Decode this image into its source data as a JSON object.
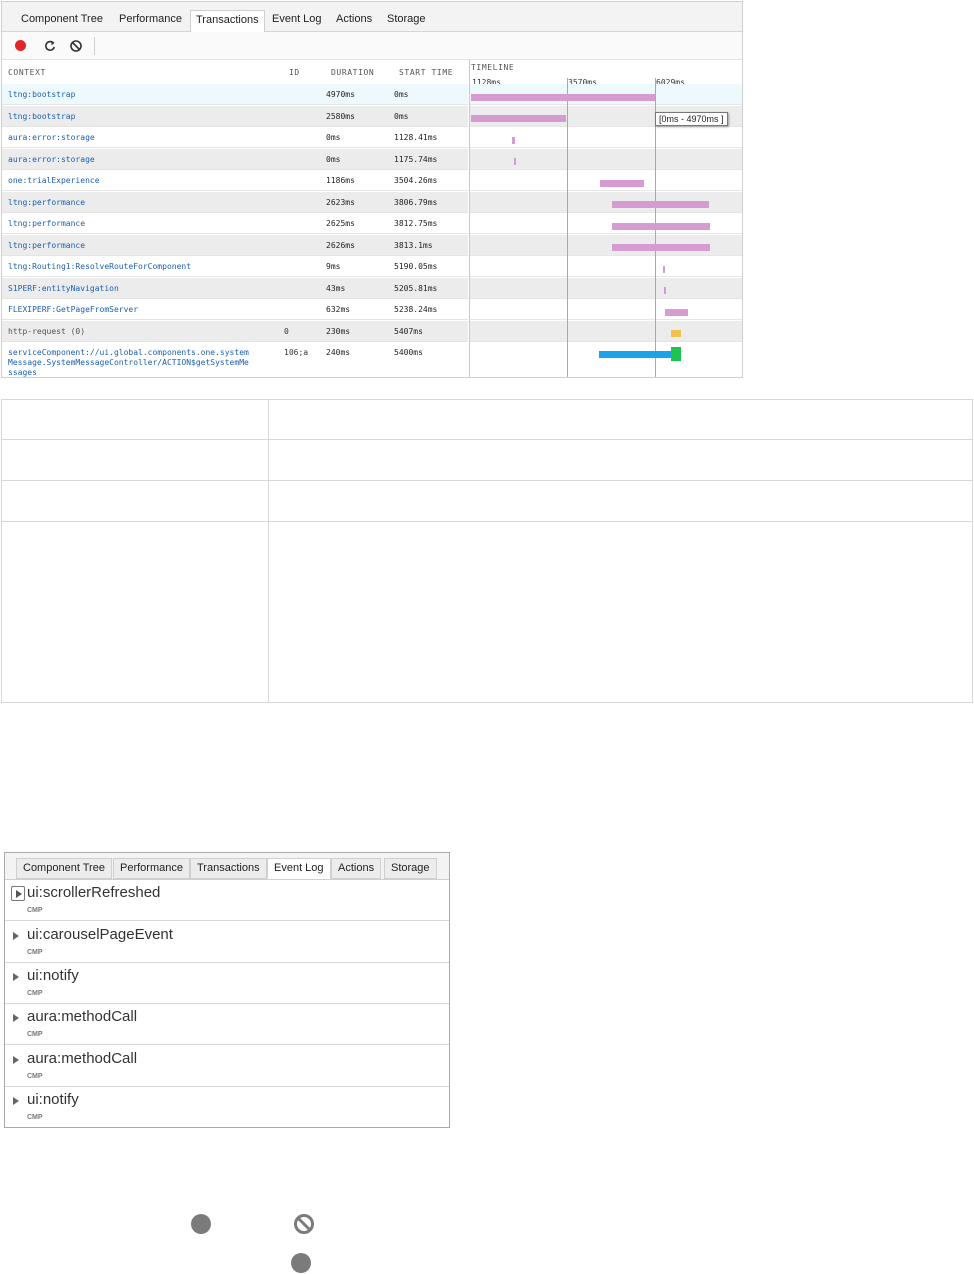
{
  "transactions_panel": {
    "tabs": [
      "Component Tree",
      "Performance",
      "Transactions",
      "Event Log",
      "Actions",
      "Storage"
    ],
    "active_tab": "Transactions",
    "toolbar": {
      "record": "record-icon",
      "refresh": "refresh-icon",
      "clear": "clear-icon"
    },
    "columns": {
      "context": "CONTEXT",
      "id": "ID",
      "duration": "DURATION",
      "start_time": "START TIME",
      "timeline": "TIMELINE"
    },
    "timeline_ticks": [
      "1128ms",
      "3570ms",
      "6029ms"
    ],
    "tooltip": "[0ms - 4970ms ]",
    "rows": [
      {
        "context": "ltng:bootstrap",
        "id": "",
        "duration": "4970ms",
        "start": "0ms"
      },
      {
        "context": "ltng:bootstrap",
        "id": "",
        "duration": "2580ms",
        "start": "0ms"
      },
      {
        "context": "aura:error:storage",
        "id": "",
        "duration": "0ms",
        "start": "1128.41ms"
      },
      {
        "context": "aura:error:storage",
        "id": "",
        "duration": "0ms",
        "start": "1175.74ms"
      },
      {
        "context": "one:trialExperience",
        "id": "",
        "duration": "1186ms",
        "start": "3504.26ms"
      },
      {
        "context": "ltng:performance",
        "id": "",
        "duration": "2623ms",
        "start": "3806.79ms"
      },
      {
        "context": "ltng:performance",
        "id": "",
        "duration": "2625ms",
        "start": "3812.75ms"
      },
      {
        "context": "ltng:performance",
        "id": "",
        "duration": "2626ms",
        "start": "3813.1ms"
      },
      {
        "context": "ltng:Routing1:ResolveRouteForComponent",
        "id": "",
        "duration": "9ms",
        "start": "5190.05ms"
      },
      {
        "context": "S1PERF:entityNavigation",
        "id": "",
        "duration": "43ms",
        "start": "5205.81ms"
      },
      {
        "context": "FLEXIPERF:GetPageFromServer",
        "id": "",
        "duration": "632ms",
        "start": "5238.24ms"
      },
      {
        "context": "http-request (0)",
        "id": "0",
        "duration": "230ms",
        "start": "5407ms"
      },
      {
        "context_lines": [
          "serviceComponent://ui.global.components.one.system",
          "Message.SystemMessageController/ACTION$getSystemMe",
          "ssages"
        ],
        "id": "106;a",
        "duration": "240ms",
        "start": "5400ms"
      }
    ],
    "colors": {
      "bar": "#d69bd1",
      "http_bar": "#f2c14e",
      "action_bar": "#1aa3e8",
      "action_end": "#1ec452"
    }
  },
  "event_log_panel": {
    "tabs": [
      "Component Tree",
      "Performance",
      "Transactions",
      "Event Log",
      "Actions",
      "Storage"
    ],
    "active_tab": "Event Log",
    "events": [
      {
        "name": "ui:scrollerRefreshed",
        "type": "CMP"
      },
      {
        "name": "ui:carouselPageEvent",
        "type": "CMP"
      },
      {
        "name": "ui:notify",
        "type": "CMP"
      },
      {
        "name": "aura:methodCall",
        "type": "CMP"
      },
      {
        "name": "aura:methodCall",
        "type": "CMP"
      },
      {
        "name": "ui:notify",
        "type": "CMP"
      }
    ]
  }
}
